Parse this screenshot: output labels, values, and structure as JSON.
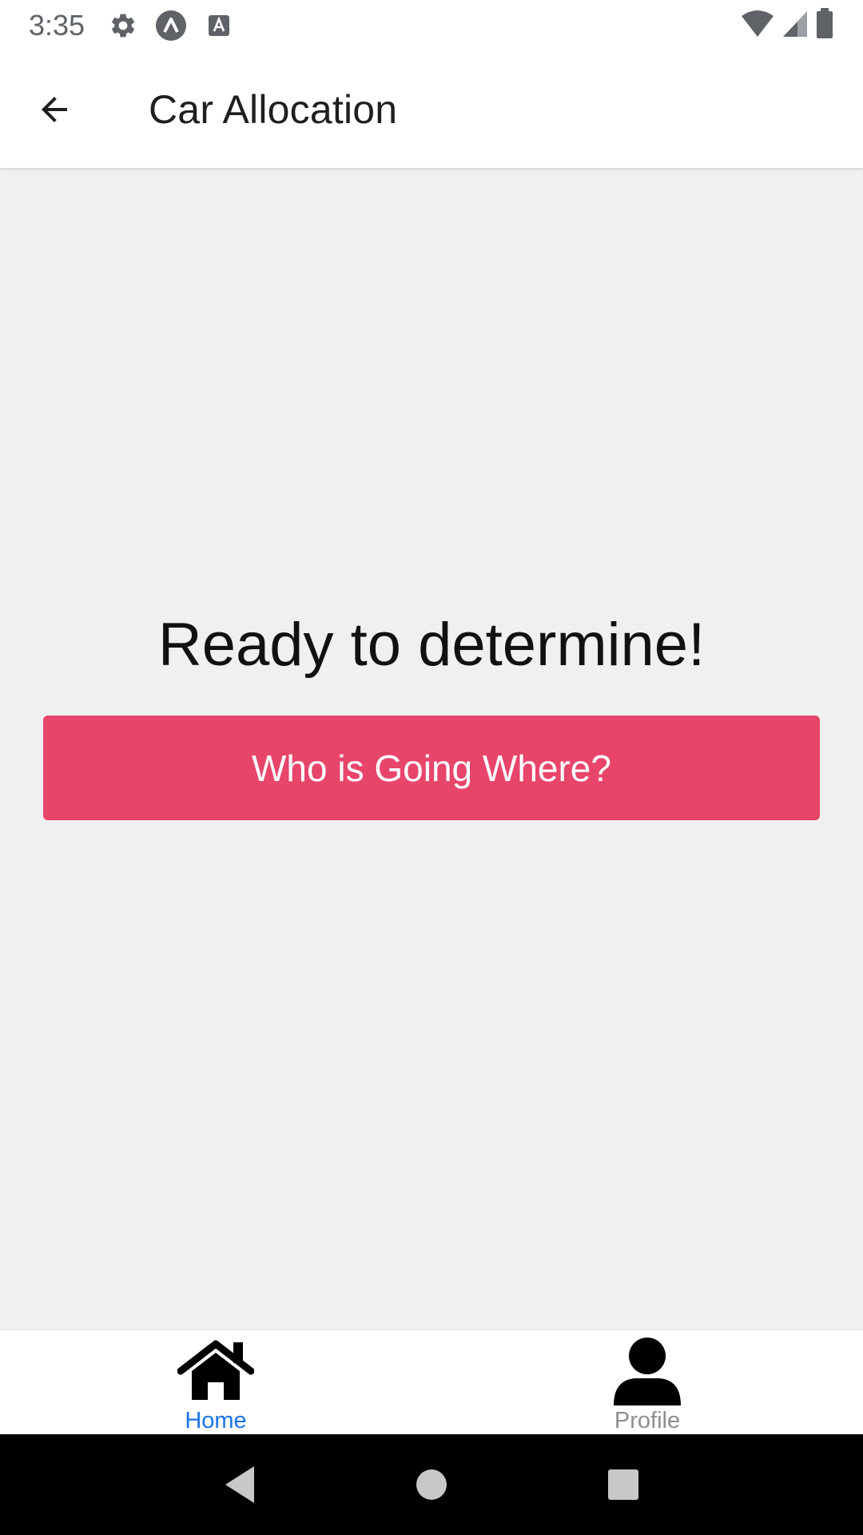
{
  "status_bar": {
    "time": "3:35",
    "icons_left": [
      "settings-icon",
      "app-notification-icon",
      "text-notification-icon"
    ],
    "icons_right": [
      "wifi-icon",
      "cell-signal-icon",
      "battery-icon"
    ]
  },
  "app_bar": {
    "title": "Car Allocation",
    "back_icon": "arrow-back-icon"
  },
  "main": {
    "headline": "Ready to determine!",
    "button_label": "Who is Going Where?",
    "button_color": "#e8456b"
  },
  "tab_bar": {
    "tabs": [
      {
        "label": "Home",
        "icon": "home-icon",
        "active": true
      },
      {
        "label": "Profile",
        "icon": "person-icon",
        "active": false
      }
    ],
    "active_color": "#1a73e8",
    "inactive_color": "#8e8e8e"
  },
  "nav_bar": {
    "buttons": [
      "back-triangle-icon",
      "home-circle-icon",
      "recents-square-icon"
    ]
  }
}
